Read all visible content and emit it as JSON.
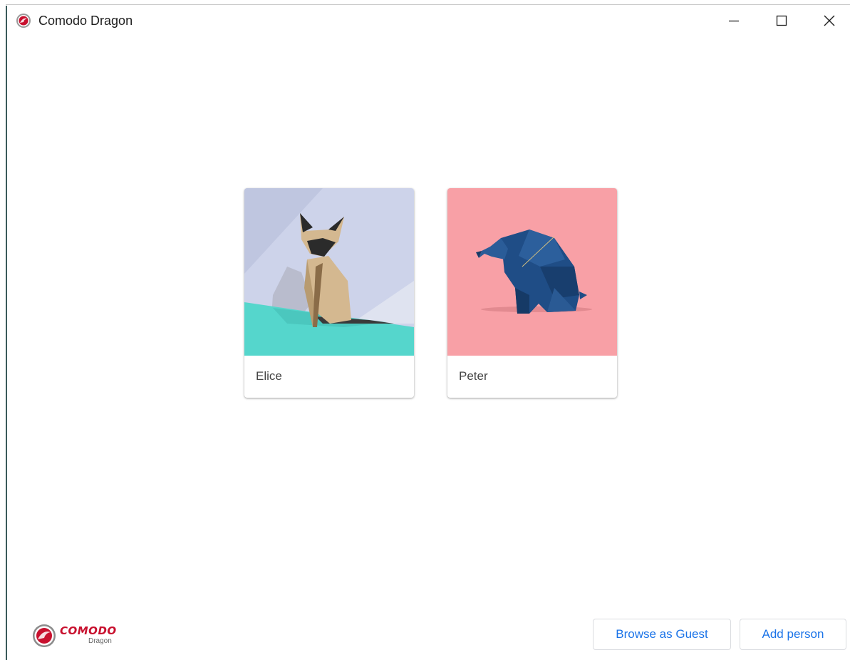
{
  "window": {
    "title": "Comodo Dragon",
    "controls": {
      "minimize": "minimize-icon",
      "maximize": "maximize-icon",
      "close": "close-icon"
    }
  },
  "profiles": [
    {
      "name": "Elice",
      "avatar": "origami-cat"
    },
    {
      "name": "Peter",
      "avatar": "origami-elephant"
    }
  ],
  "footer": {
    "logo_text": "COMODO",
    "logo_sub": "Dragon",
    "browse_guest_label": "Browse as Guest",
    "add_person_label": "Add person"
  },
  "colors": {
    "accent": "#1a73e8",
    "brand_red": "#c8102e",
    "elephant_bg": "#f8a0a6",
    "cat_bg": "#cdd3ea",
    "cat_ground": "#55d6cc"
  }
}
